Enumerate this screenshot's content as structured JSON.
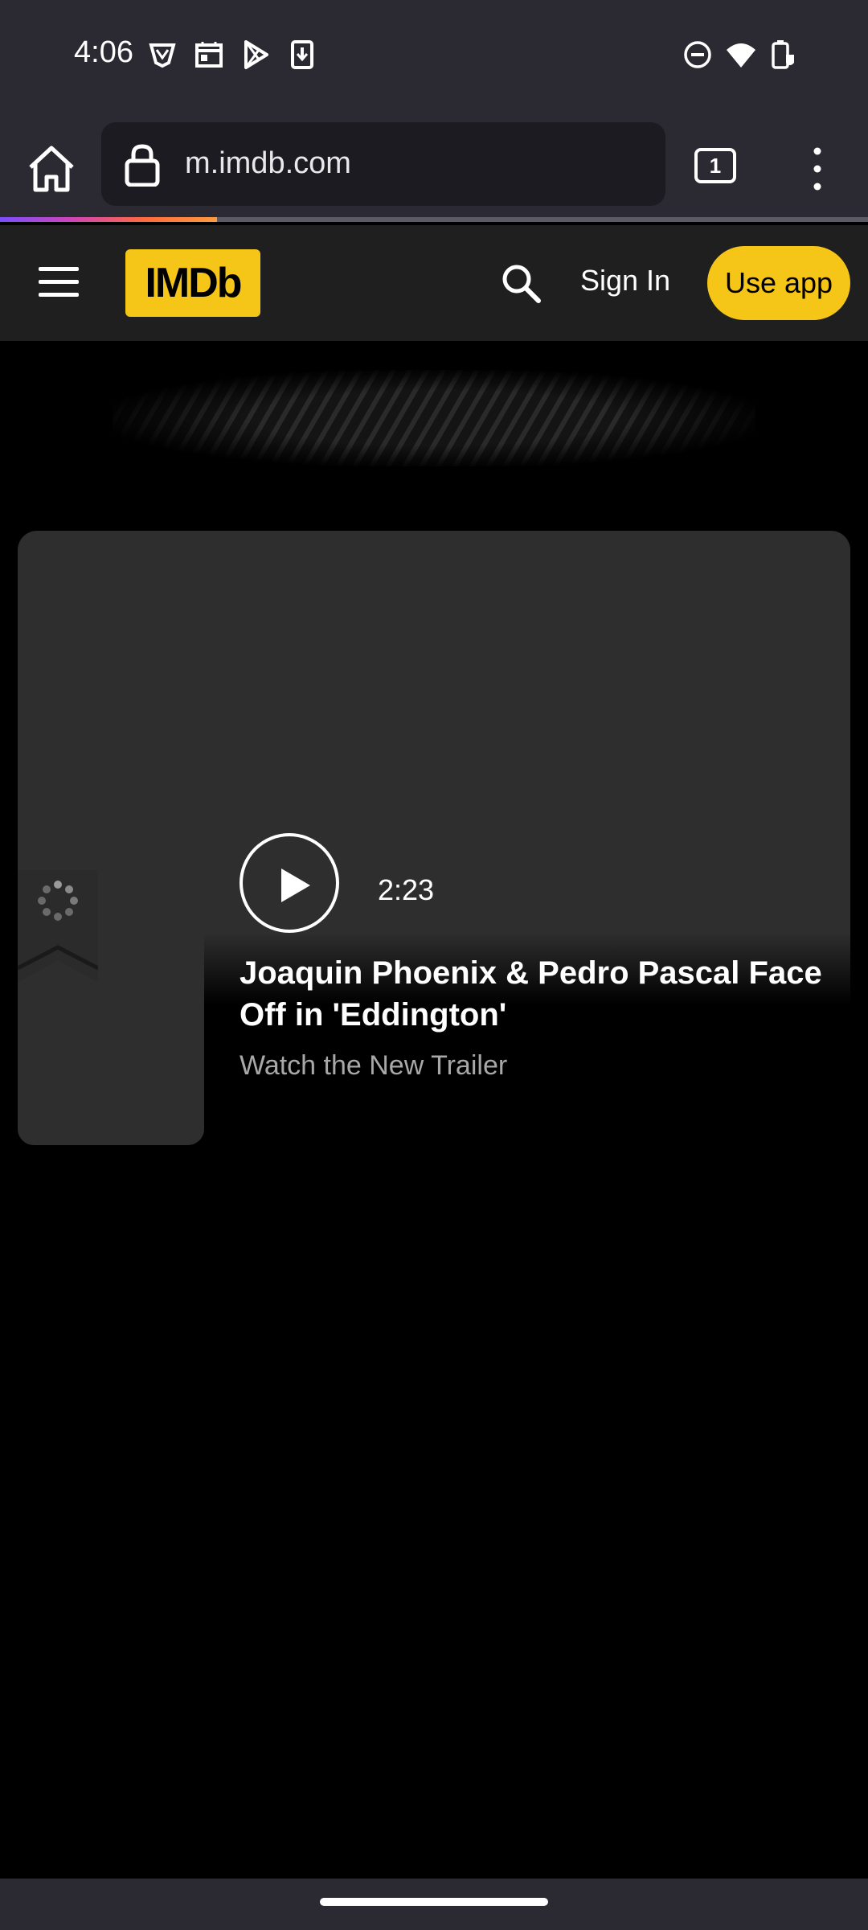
{
  "status_bar": {
    "time": "4:06",
    "icons": [
      "vpn-shield-icon",
      "calendar-icon",
      "play-store-icon",
      "download-icon",
      "do-not-disturb-icon",
      "wifi-icon",
      "battery-icon"
    ]
  },
  "browser": {
    "url": "m.imdb.com",
    "tab_count": "1",
    "page_load_progress": 0.25,
    "icons": [
      "home-icon",
      "lock-icon",
      "tabs-icon",
      "more-vert-icon"
    ]
  },
  "imdb_header": {
    "logo_text": "IMDb",
    "sign_in_label": "Sign In",
    "use_app_label": "Use app",
    "accent_color": "#f5c518",
    "icons": [
      "menu-icon",
      "search-icon"
    ]
  },
  "hero": {
    "duration": "2:23",
    "title": "Joaquin Phoenix & Pedro Pascal Face Off in 'Eddington'",
    "subtitle": "Watch the New Trailer",
    "icons": [
      "play-icon",
      "loading-spinner-icon",
      "watchlist-ribbon-icon"
    ]
  }
}
